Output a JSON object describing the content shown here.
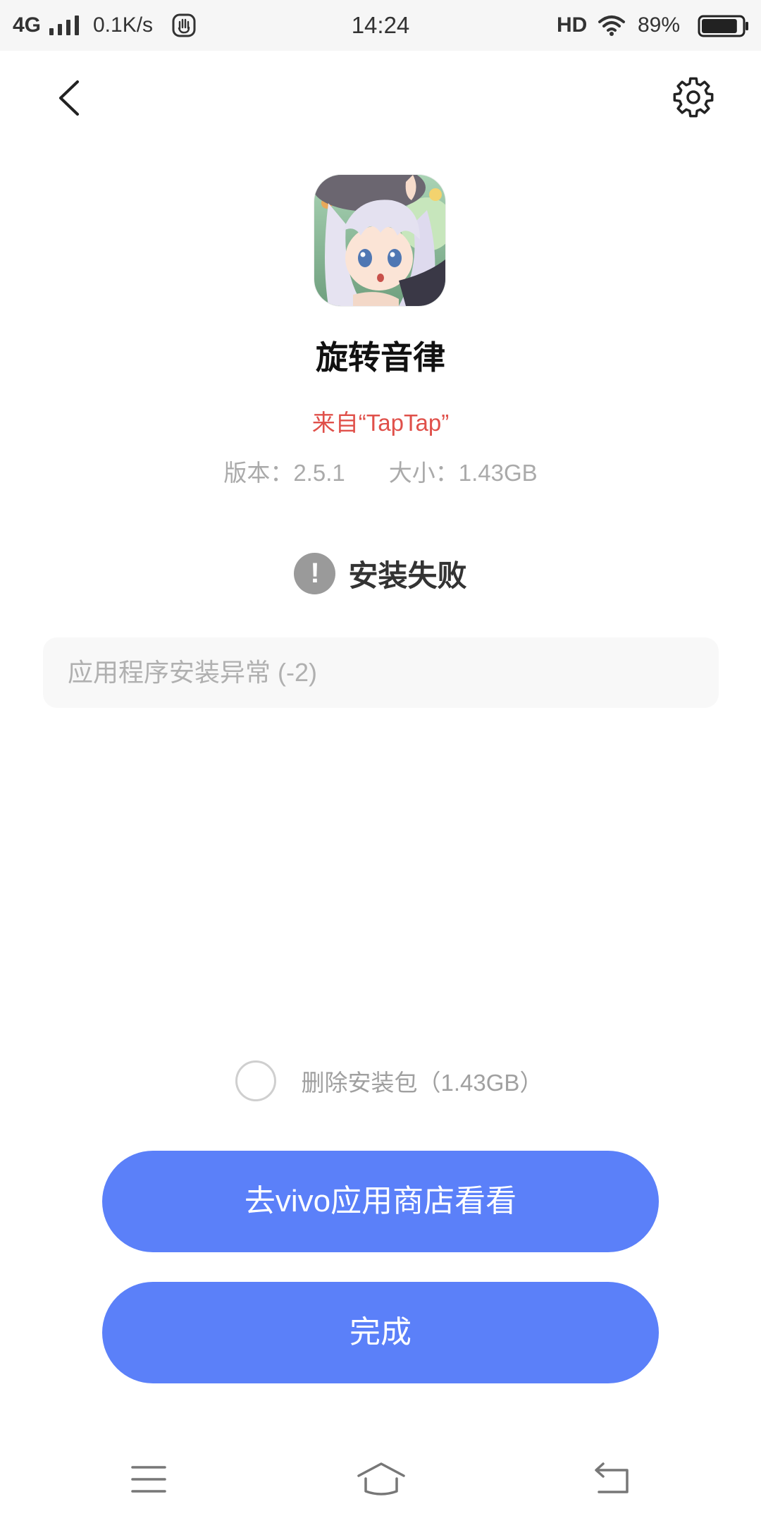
{
  "status_bar": {
    "network": "4G",
    "speed": "0.1K/s",
    "time": "14:24",
    "hd": "HD",
    "battery": "89%",
    "battery_level": 0.89,
    "icons": [
      "signal-icon",
      "hand-icon",
      "wifi-icon",
      "battery-icon"
    ]
  },
  "header": {
    "back_icon": "back-arrow-icon",
    "settings_icon": "gear-icon"
  },
  "app": {
    "icon": "app-icon",
    "name": "旋转音律",
    "source": "来自“TapTap”",
    "version": "版本：2.5.1",
    "size": "大小：1.43GB"
  },
  "install": {
    "status_icon": "exclamation-icon",
    "status_symbol": "!",
    "status": "安装失败",
    "error_message": "应用程序安装异常 (-2)"
  },
  "delete_package": {
    "label": "删除安装包（1.43GB）",
    "checked": false
  },
  "actions": {
    "store_button": "去vivo应用商店看看",
    "done_button": "完成"
  },
  "nav_bar": {
    "icons": [
      "menu-icon",
      "home-icon",
      "back-icon"
    ]
  },
  "colors": {
    "accent": "#5b80f9",
    "source_text": "#e0504a",
    "muted_text": "#aaaaaa",
    "status_icon": "#9a9a9a"
  }
}
